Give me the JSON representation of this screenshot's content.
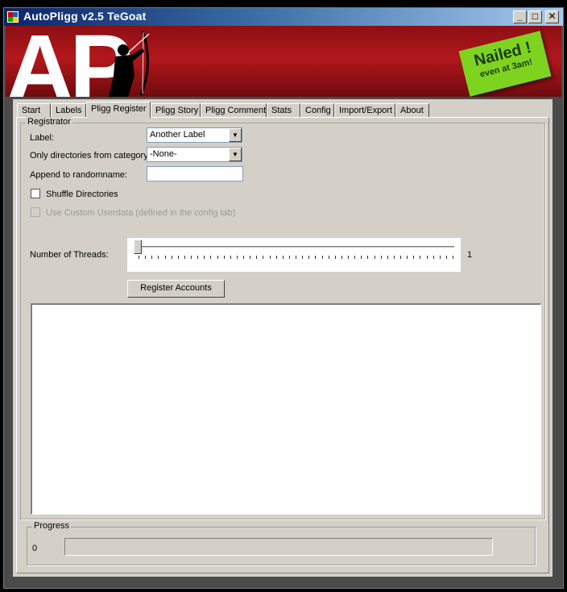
{
  "window": {
    "title": "AutoPligg v2.5 TeGoat",
    "minimize_glyph": "_",
    "maximize_glyph": "□",
    "close_glyph": "✕"
  },
  "banner": {
    "logo_text": "AP",
    "note_main": "Nailed !",
    "note_sub": "even at 3am!",
    "icon": "archer-silhouette-icon"
  },
  "tabs": [
    {
      "label": "Start"
    },
    {
      "label": "Labels"
    },
    {
      "label": "Pligg Register",
      "active": true
    },
    {
      "label": "Pligg Story"
    },
    {
      "label": "Pligg Comment"
    },
    {
      "label": "Stats"
    },
    {
      "label": "Config"
    },
    {
      "label": "Import/Export"
    },
    {
      "label": "About"
    }
  ],
  "registrator": {
    "group_title": "Registrator",
    "label_caption": "Label:",
    "label_value": "Another Label",
    "category_caption": "Only directories from category:",
    "category_value": "-None-",
    "append_caption": "Append to randomname:",
    "append_value": "",
    "shuffle_label": "Shuffle Directories",
    "shuffle_checked": false,
    "custom_userdata_label": "Use Custom Userdata (defined in the config tab)",
    "custom_userdata_checked": false,
    "custom_userdata_enabled": false,
    "threads_caption": "Number of Threads:",
    "threads_value": "1",
    "threads_slider_level": 0,
    "register_button": "Register Accounts",
    "log_text": ""
  },
  "progress": {
    "group_title": "Progress",
    "count": "0",
    "fraction": 0
  },
  "colors": {
    "banner_red": "#b3171c",
    "note_green": "#7ed321",
    "titlebar_blue": "#0a246a"
  }
}
